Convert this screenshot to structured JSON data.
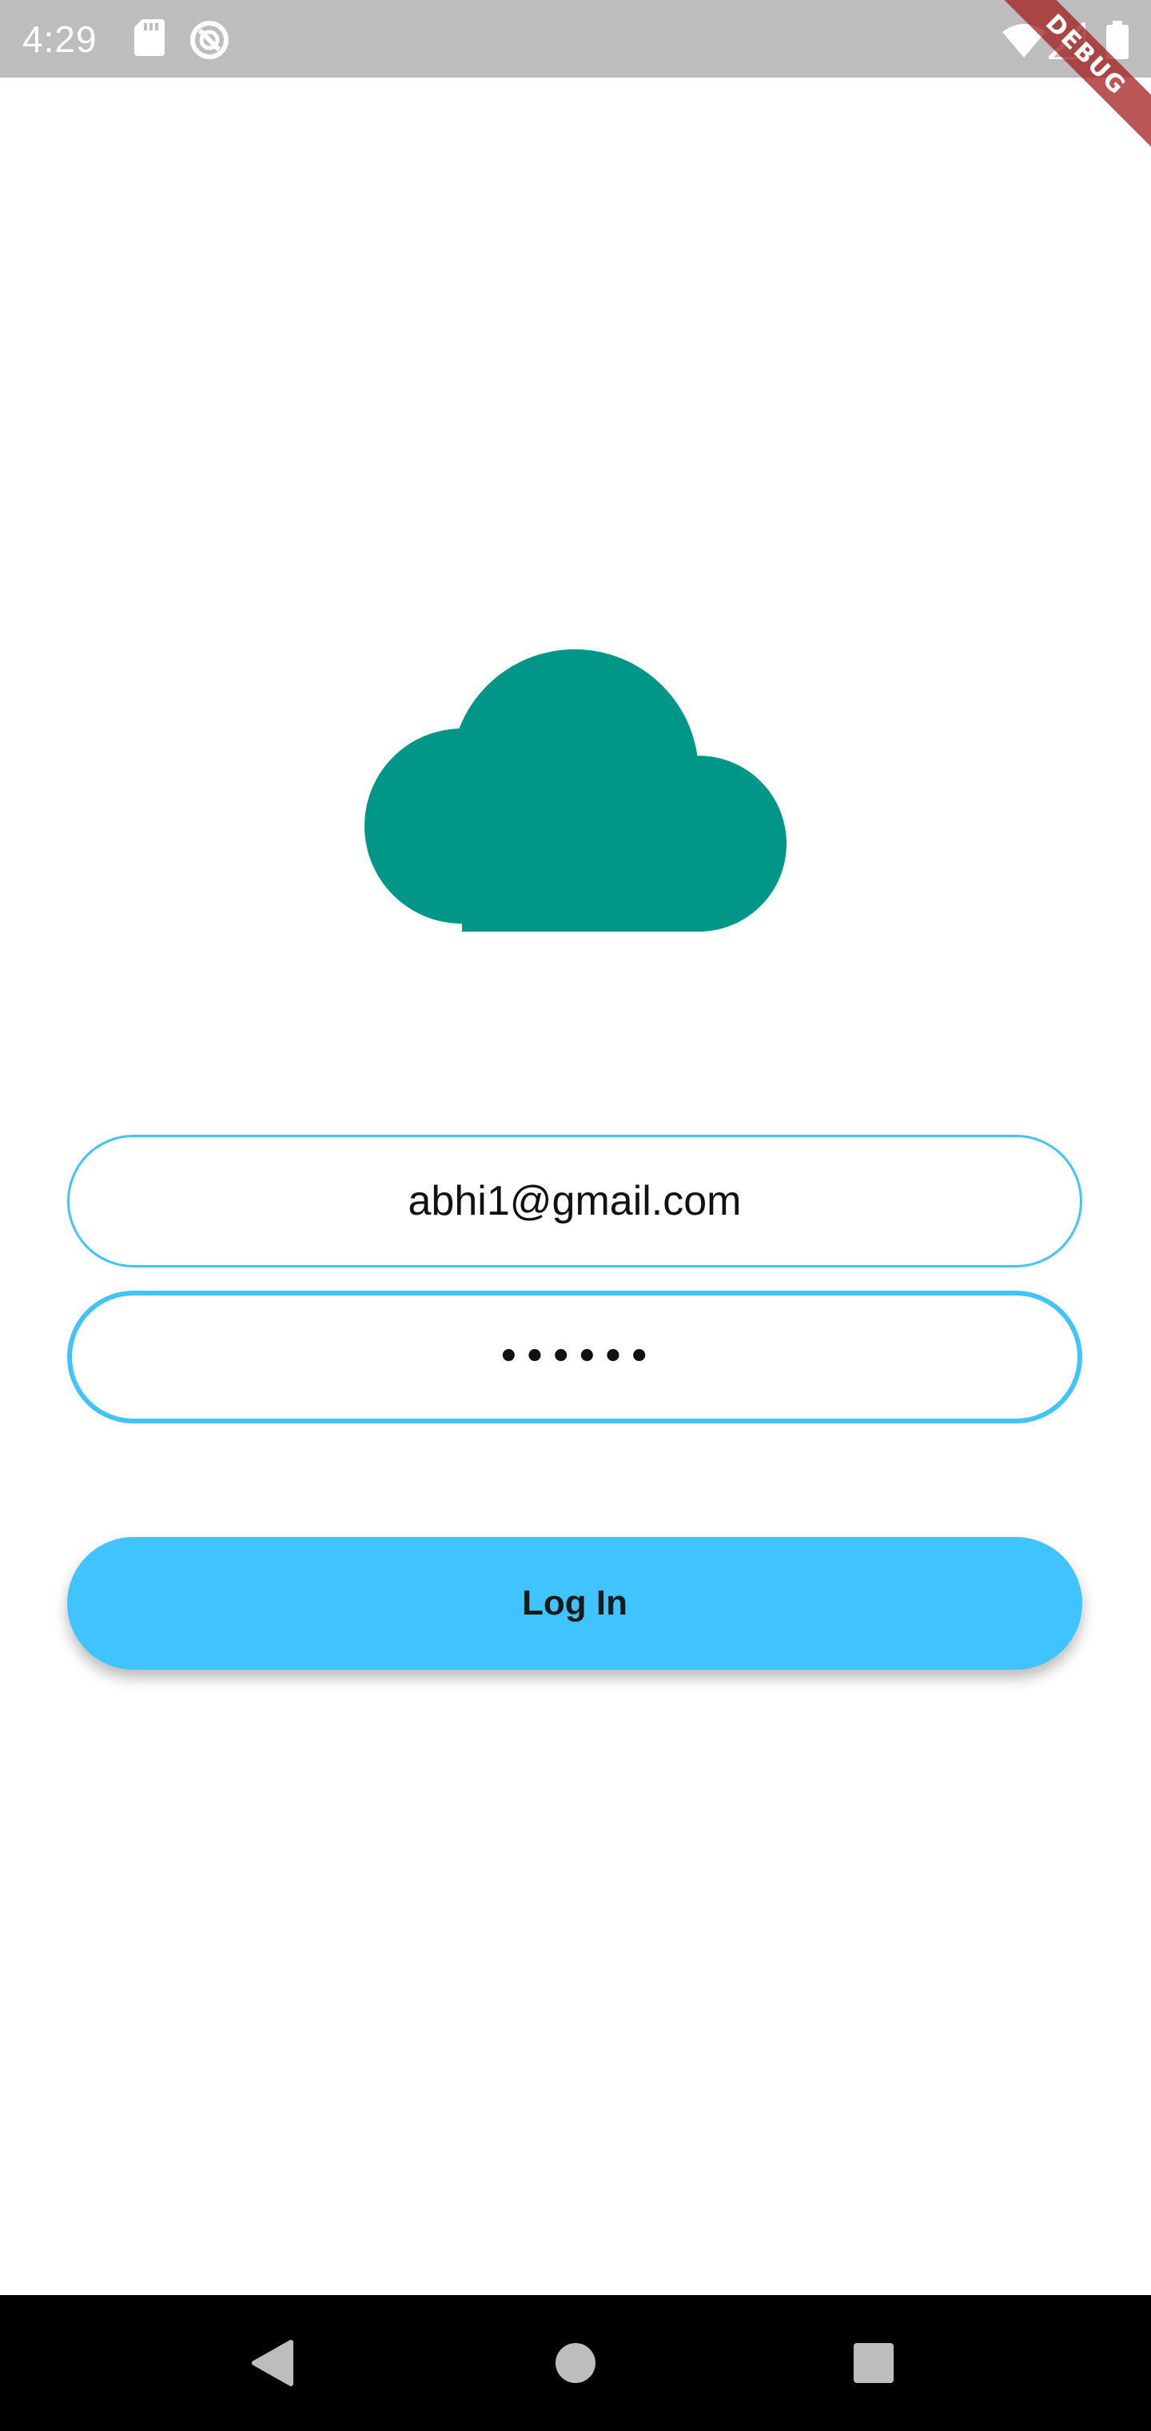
{
  "status_bar": {
    "time": "4:29",
    "icons": [
      "sd-card-icon",
      "sync-icon",
      "wifi-icon",
      "signal-icon",
      "battery-icon"
    ]
  },
  "debug_banner": {
    "label": "DEBUG"
  },
  "logo": {
    "icon": "cloud-icon",
    "color": "#009688"
  },
  "form": {
    "email_value": "abhi1@gmail.com",
    "password_value": "••••••",
    "accent_color": "#40c4ff"
  },
  "login_button": {
    "label": "Log In",
    "color": "#40c4ff"
  },
  "nav_bar": {
    "buttons": [
      "back-icon",
      "home-icon",
      "recents-icon"
    ]
  }
}
